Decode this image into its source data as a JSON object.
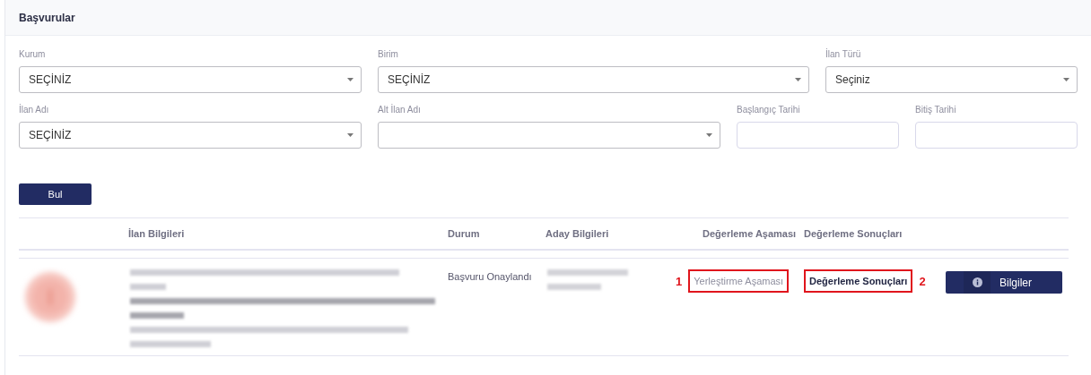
{
  "page_title": "Başvurular",
  "filters": [
    {
      "label": "Kurum",
      "kind": "select",
      "value": "SEÇİNİZ"
    },
    {
      "label": "Birim",
      "kind": "select",
      "value": "SEÇİNİZ"
    },
    {
      "label": "İlan Türü",
      "kind": "select",
      "value": "Seçiniz"
    },
    {
      "label": "İlan Adı",
      "kind": "select",
      "value": "SEÇİNİZ"
    },
    {
      "label": "Alt İlan Adı",
      "kind": "select"
    },
    {
      "label": "Başlangıç Tarihi",
      "kind": "date"
    },
    {
      "label": "Bitiş Tarihi",
      "kind": "date"
    }
  ],
  "search_button": "Bul",
  "table": {
    "columns": [
      "İlan Bilgileri",
      "Durum",
      "Aday Bilgileri",
      "Değerleme Aşaması",
      "Değerleme Sonuçları"
    ],
    "rows": [
      {
        "listing_info": {
          "kind": "redacted"
        },
        "status": "Başvuru Onaylandı",
        "candidate_info": {
          "kind": "redacted"
        },
        "stage": {
          "text": "Yerleştirme Aşaması",
          "annotation": "1"
        },
        "results": {
          "text": "Değerleme Sonuçları",
          "annotation": "2"
        },
        "button": "Bilgiler"
      }
    ]
  }
}
